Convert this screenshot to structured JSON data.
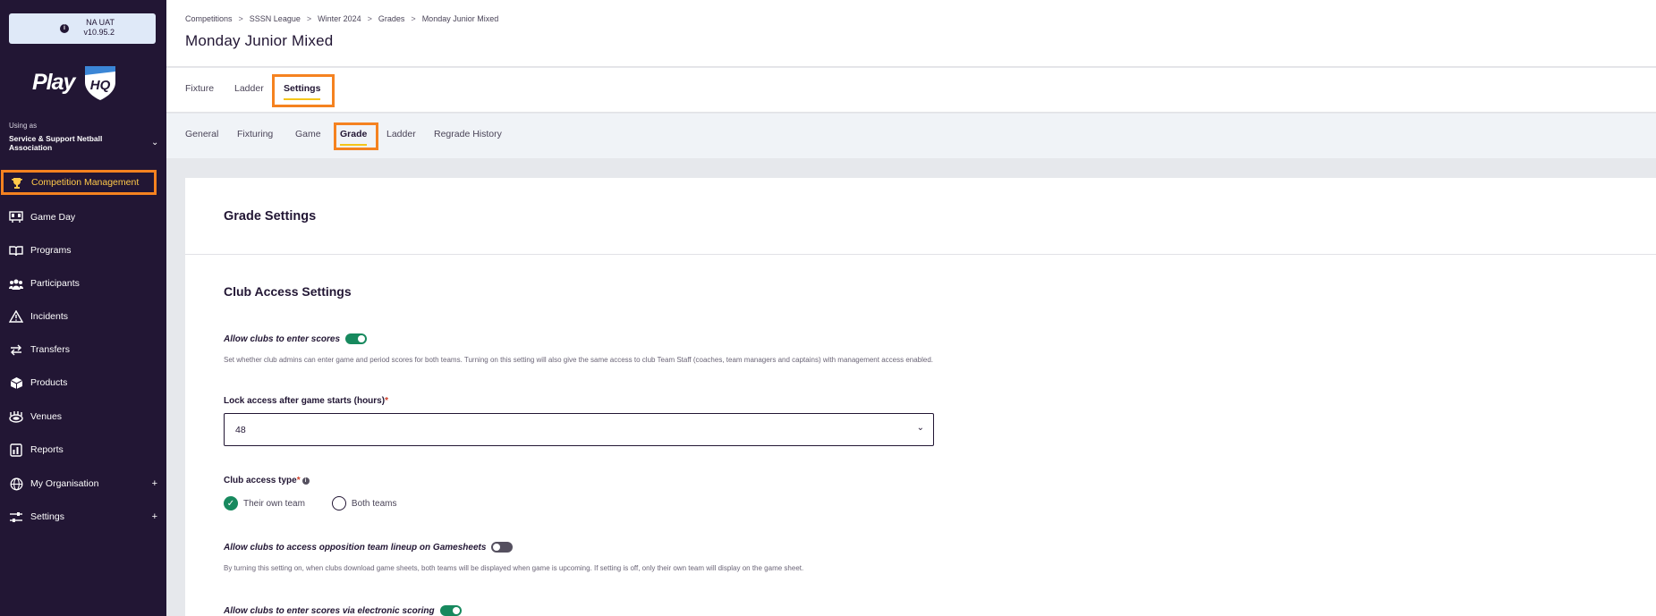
{
  "env": {
    "name": "NA UAT",
    "version": "v10.95.2"
  },
  "brand": {
    "logo_text": "Play",
    "logo_mark": "HQ",
    "accent": "#f58220",
    "sidebar_bg": "#221634",
    "active_color": "#ffc94a",
    "toggle_on": "#17895e"
  },
  "org": {
    "using_as_label": "Using as",
    "name": "Service & Support Netball Association"
  },
  "nav": {
    "competition": {
      "label": "Competition Management",
      "icon": "trophy-icon"
    },
    "gameday": {
      "label": "Game Day",
      "icon": "scoreboard-icon"
    },
    "programs": {
      "label": "Programs",
      "icon": "book-icon"
    },
    "participants": {
      "label": "Participants",
      "icon": "people-icon"
    },
    "incidents": {
      "label": "Incidents",
      "icon": "warning-icon"
    },
    "transfers": {
      "label": "Transfers",
      "icon": "transfer-arrows-icon"
    },
    "products": {
      "label": "Products",
      "icon": "box-icon"
    },
    "venues": {
      "label": "Venues",
      "icon": "stadium-icon"
    },
    "reports": {
      "label": "Reports",
      "icon": "report-icon"
    },
    "organisation": {
      "label": "My Organisation",
      "icon": "globe-icon"
    },
    "settings": {
      "label": "Settings",
      "icon": "sliders-icon"
    }
  },
  "breadcrumb": {
    "c0": "Competitions",
    "c1": "SSSN League",
    "c2": "Winter 2024",
    "c3": "Grades",
    "c4": "Monday Junior Mixed",
    "sep": ">"
  },
  "page": {
    "title": "Monday Junior Mixed"
  },
  "tabs": {
    "fixture": "Fixture",
    "ladder": "Ladder",
    "settings": "Settings"
  },
  "subtabs": {
    "general": "General",
    "fixturing": "Fixturing",
    "game": "Game",
    "grade": "Grade",
    "ladder": "Ladder",
    "regrade": "Regrade History"
  },
  "content": {
    "title": "Grade Settings",
    "section": "Club Access Settings",
    "allow_scores": {
      "label": "Allow clubs to enter scores",
      "on": true,
      "help": "Set whether club admins can enter game and period scores for both teams. Turning on this setting will also give the same access to club Team Staff (coaches, team managers and captains) with management access enabled."
    },
    "lock_access": {
      "label": "Lock access after game starts (hours)",
      "required": "*",
      "value": "48"
    },
    "club_access": {
      "label": "Club access type",
      "required": "*",
      "options": [
        "Their own team",
        "Both teams"
      ],
      "selected": "Their own team"
    },
    "opposition": {
      "label": "Allow clubs to access opposition team lineup on Gamesheets",
      "on": false,
      "help": "By turning this setting on, when clubs download game sheets, both teams will be displayed when game is upcoming. If setting is off, only their own team will display on the game sheet."
    },
    "electronic": {
      "label": "Allow clubs to enter scores via electronic scoring",
      "on": true
    }
  }
}
